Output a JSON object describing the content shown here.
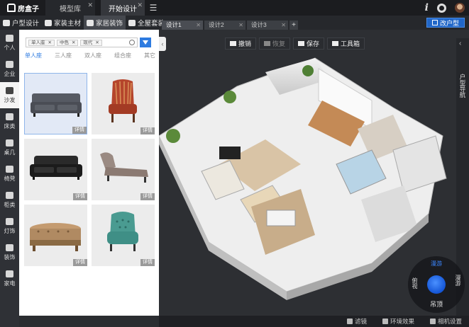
{
  "app": {
    "logo_text": "房盒子"
  },
  "top_tabs": [
    {
      "label": "模型库"
    },
    {
      "label": "开始设计"
    }
  ],
  "toolbar": {
    "items": [
      {
        "label": "户型设计"
      },
      {
        "label": "家装主材"
      },
      {
        "label": "家居装饰"
      },
      {
        "label": "全屋套装"
      }
    ],
    "change_layout_label": "改户型"
  },
  "design_tabs": [
    {
      "label": "设计1"
    },
    {
      "label": "设计2"
    },
    {
      "label": "设计3"
    }
  ],
  "left_nav": [
    {
      "label": "个人"
    },
    {
      "label": "企业"
    },
    {
      "label": "沙发"
    },
    {
      "label": "床类"
    },
    {
      "label": "桌几"
    },
    {
      "label": "椅凳"
    },
    {
      "label": "柜类"
    },
    {
      "label": "灯饰"
    },
    {
      "label": "装饰"
    },
    {
      "label": "家电"
    }
  ],
  "filter": {
    "tags": [
      "单人座",
      "中色",
      "现代"
    ]
  },
  "categories": [
    "单人座",
    "三人座",
    "双人座",
    "组合座",
    "其它"
  ],
  "products": [
    {
      "detail_label": "详情",
      "kind": "grey-fabric-loveseat",
      "color": "#4a4d55"
    },
    {
      "detail_label": "详情",
      "kind": "striped-wingback-chair",
      "color": "#b5452c"
    },
    {
      "detail_label": "详情",
      "kind": "black-leather-loveseat",
      "color": "#222222"
    },
    {
      "detail_label": "详情",
      "kind": "chaise-lounge",
      "color": "#8b7a72"
    },
    {
      "detail_label": "详情",
      "kind": "tufted-ottoman-bench",
      "color": "#b08a62"
    },
    {
      "detail_label": "详情",
      "kind": "teal-tufted-armchair",
      "color": "#3f8f86"
    }
  ],
  "viewport": {
    "buttons": [
      {
        "label": "撤销"
      },
      {
        "label": "恢复"
      },
      {
        "label": "保存"
      },
      {
        "label": "工具箱"
      }
    ],
    "right_panel_label": "户型导航"
  },
  "compass": {
    "top": "漫游",
    "bottom": "吊顶",
    "left": "俯视",
    "right": "漫游"
  },
  "status": [
    {
      "label": "滤镜"
    },
    {
      "label": "环境效果"
    },
    {
      "label": "相机设置"
    }
  ]
}
